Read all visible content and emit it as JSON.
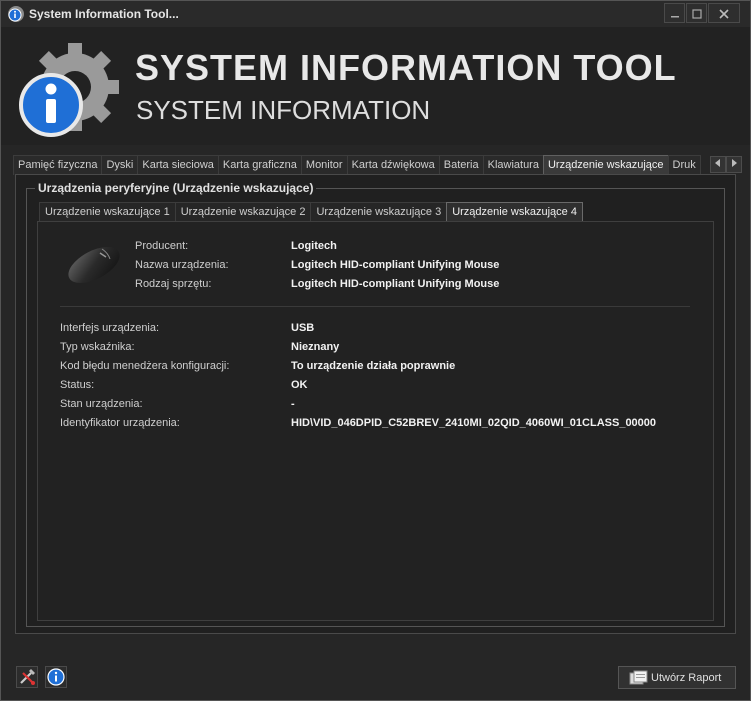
{
  "window": {
    "title": "System Information Tool..."
  },
  "header": {
    "title": "SYSTEM INFORMATION TOOL",
    "subtitle": "SYSTEM INFORMATION"
  },
  "tabs": [
    {
      "label": "Pamięć fizyczna"
    },
    {
      "label": "Dyski"
    },
    {
      "label": "Karta sieciowa"
    },
    {
      "label": "Karta graficzna"
    },
    {
      "label": "Monitor"
    },
    {
      "label": "Karta dźwiękowa"
    },
    {
      "label": "Bateria"
    },
    {
      "label": "Klawiatura"
    },
    {
      "label": "Urządzenie wskazujące"
    },
    {
      "label": "Druk"
    }
  ],
  "group": {
    "title": "Urządzenia peryferyjne (Urządzenie wskazujące)"
  },
  "subtabs": [
    {
      "label": "Urządzenie wskazujące 1"
    },
    {
      "label": "Urządzenie wskazujące 2"
    },
    {
      "label": "Urządzenie wskazujące 3"
    },
    {
      "label": "Urządzenie wskazujące 4"
    }
  ],
  "device": {
    "rows": [
      {
        "label": "Producent:",
        "value": "Logitech"
      },
      {
        "label": "Nazwa urządzenia:",
        "value": "Logitech HID-compliant Unifying Mouse"
      },
      {
        "label": "Rodzaj sprzętu:",
        "value": "Logitech HID-compliant Unifying Mouse"
      }
    ]
  },
  "details": {
    "rows": [
      {
        "label": "Interfejs urządzenia:",
        "value": "USB"
      },
      {
        "label": "Typ wskaźnika:",
        "value": "Nieznany"
      },
      {
        "label": "Kod błędu menedżera konfiguracji:",
        "value": "To urządzenie działa poprawnie"
      },
      {
        "label": "Status:",
        "value": "OK"
      },
      {
        "label": "Stan urządzenia:",
        "value": "-"
      },
      {
        "label": "Identyfikator urządzenia:",
        "value": "HID\\VID_046DPID_C52BREV_2410MI_02QID_4060WI_01CLASS_00000"
      }
    ]
  },
  "footer": {
    "report_label": "Utwórz Raport"
  },
  "icons": {
    "minimize": "minimize-icon",
    "maximize": "maximize-icon",
    "close": "close-icon",
    "tools": "tools-icon",
    "info": "info-icon",
    "report": "report-icon"
  },
  "colors": {
    "accent_blue": "#1f6fd6",
    "background": "#262626"
  }
}
